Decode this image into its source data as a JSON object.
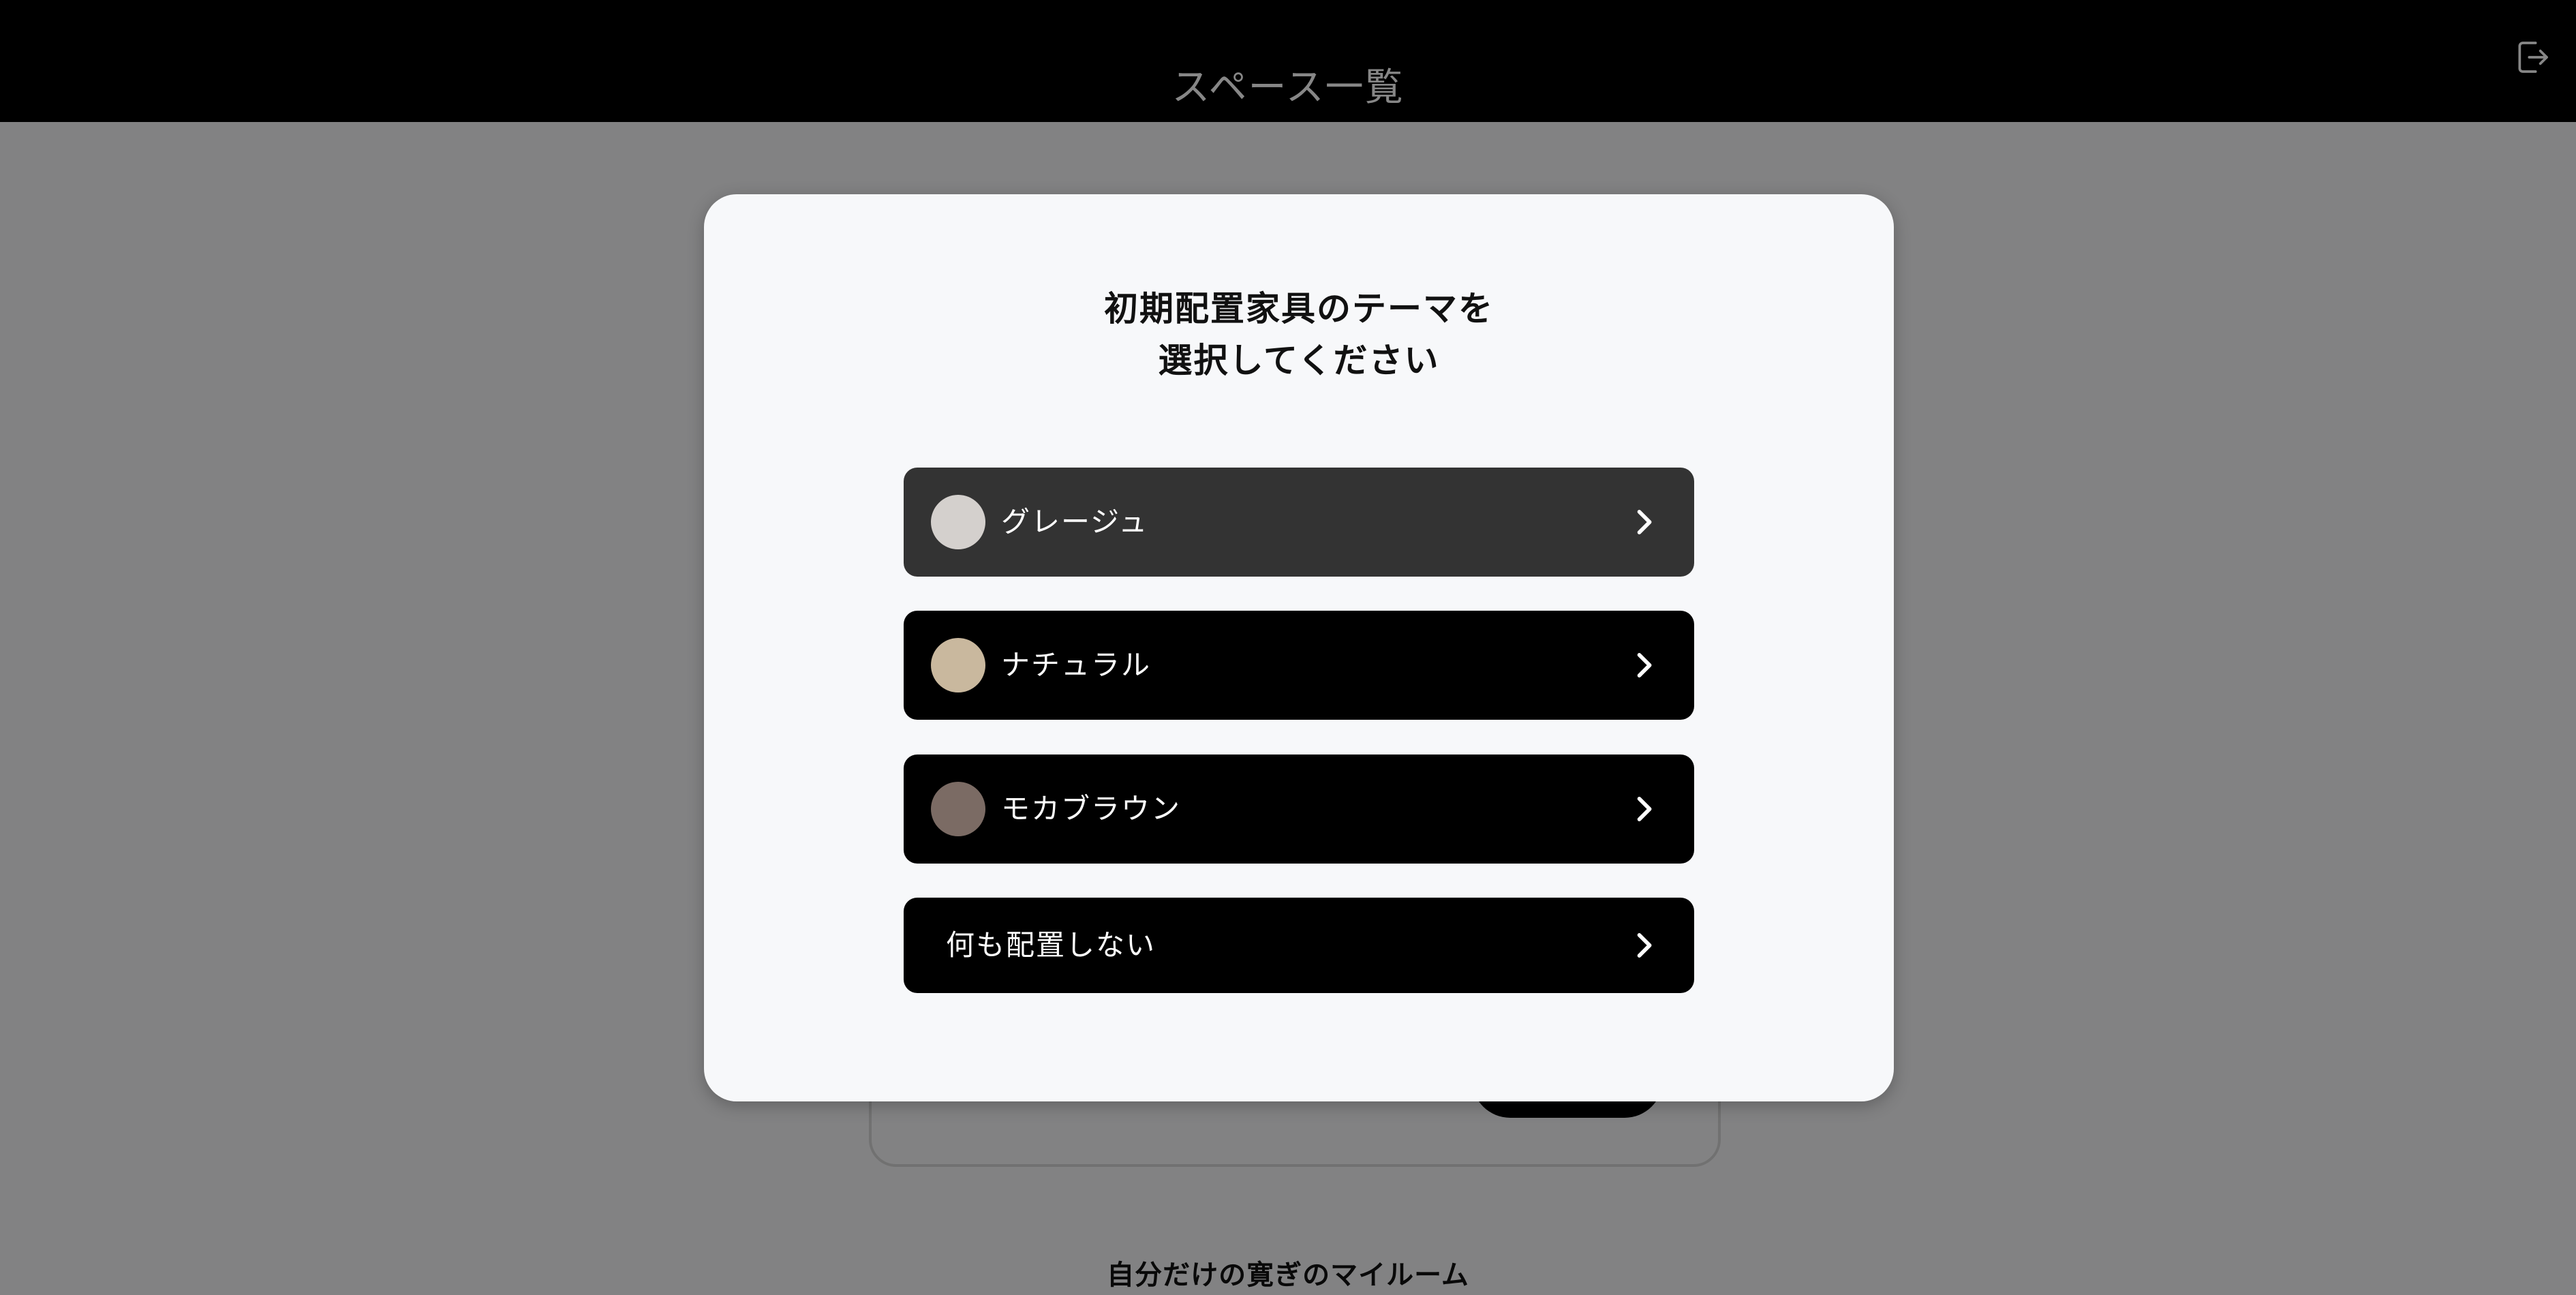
{
  "header": {
    "title": "スペース一覧",
    "logout_icon": "logout-icon"
  },
  "background": {
    "caption": "自分だけの寛ぎのマイルーム"
  },
  "modal": {
    "title_line1": "初期配置家具のテーマを",
    "title_line2": "選択してください",
    "options": [
      {
        "label": "グレージュ",
        "swatch_color": "#d4d0cd",
        "icon": "chevron-right-icon"
      },
      {
        "label": "ナチュラル",
        "swatch_color": "#c9b89e",
        "icon": "chevron-right-icon"
      },
      {
        "label": "モカブラウン",
        "swatch_color": "#7b6b64",
        "icon": "chevron-right-icon"
      },
      {
        "label": "何も配置しない",
        "icon": "chevron-right-icon"
      }
    ]
  },
  "colors": {
    "header_bg": "#000000",
    "button_bg": "#000000",
    "button_hover_bg": "#333333",
    "modal_bg": "#f7f8fa"
  }
}
